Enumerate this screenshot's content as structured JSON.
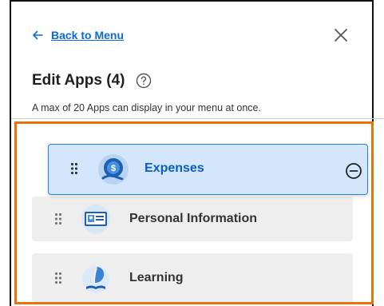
{
  "nav": {
    "back_label": "Back to Menu"
  },
  "header": {
    "title": "Edit Apps (4)",
    "subtitle": "A max of 20 Apps can display in your menu at once."
  },
  "apps": [
    {
      "label": "Expenses",
      "state": "dragging",
      "icon": "expenses-icon"
    },
    {
      "label": "Personal Information",
      "icon": "personal-information-icon"
    },
    {
      "label": "Learning",
      "icon": "learning-icon"
    }
  ],
  "colors": {
    "accent": "#0a6bd6",
    "drag_bg": "#d3e6fb",
    "highlight": "#e8730c"
  }
}
